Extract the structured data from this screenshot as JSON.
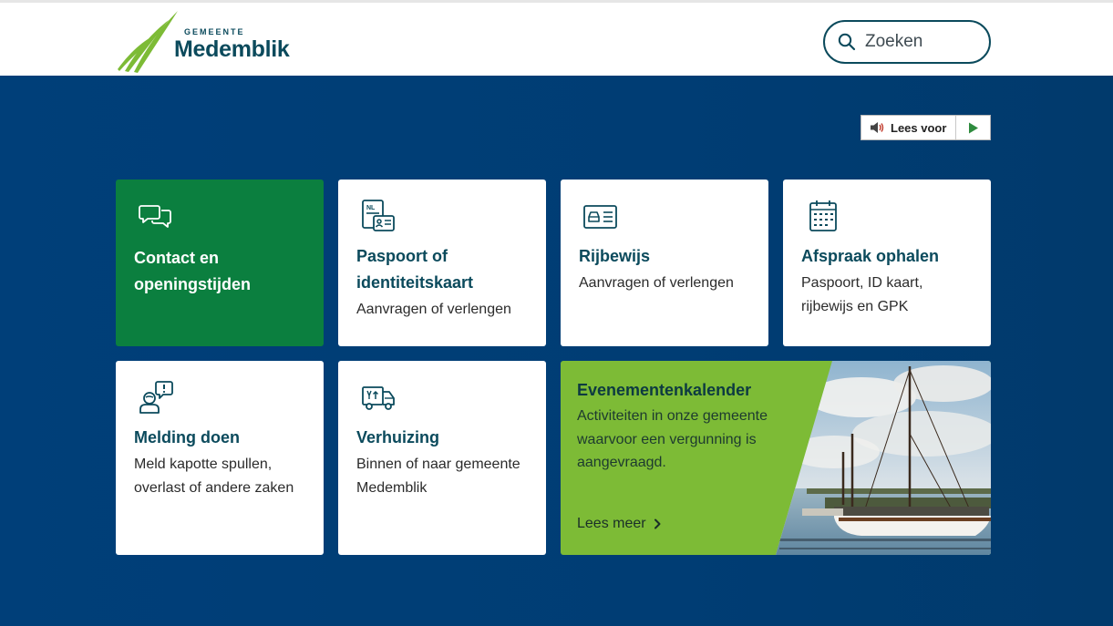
{
  "header": {
    "logo": {
      "small": "GEMEENTE",
      "big": "Medemblik"
    },
    "search": {
      "placeholder": "Zoeken"
    }
  },
  "readspeaker": {
    "label": "Lees voor"
  },
  "tiles": [
    {
      "title": "Contact en openingstijden",
      "subtitle": "",
      "icon": "chat-bubbles-icon"
    },
    {
      "title": "Paspoort of identiteitskaart",
      "subtitle": "Aanvragen of verlengen",
      "icon": "id-card-nl-icon"
    },
    {
      "title": "Rijbewijs",
      "subtitle": "Aanvragen of verlengen",
      "icon": "driving-license-icon"
    },
    {
      "title": "Afspraak ophalen",
      "subtitle": "Paspoort, ID kaart, rijbewijs en GPK",
      "icon": "calendar-icon"
    },
    {
      "title": "Melding doen",
      "subtitle": "Meld kapotte spullen, overlast of andere zaken",
      "icon": "person-report-icon"
    },
    {
      "title": "Verhuizing",
      "subtitle": "Binnen of naar gemeente Medemblik",
      "icon": "moving-truck-icon"
    }
  ],
  "event": {
    "title": "Evenementenkalender",
    "text": "Activiteiten in onze gemeente waarvoor een vergunning is aangevraagd.",
    "link": "Lees meer"
  },
  "colors": {
    "navy": "#003f79",
    "teal_text": "#0b4a5c",
    "green_tile": "#0b7f3f",
    "lime": "#7dbb36"
  }
}
